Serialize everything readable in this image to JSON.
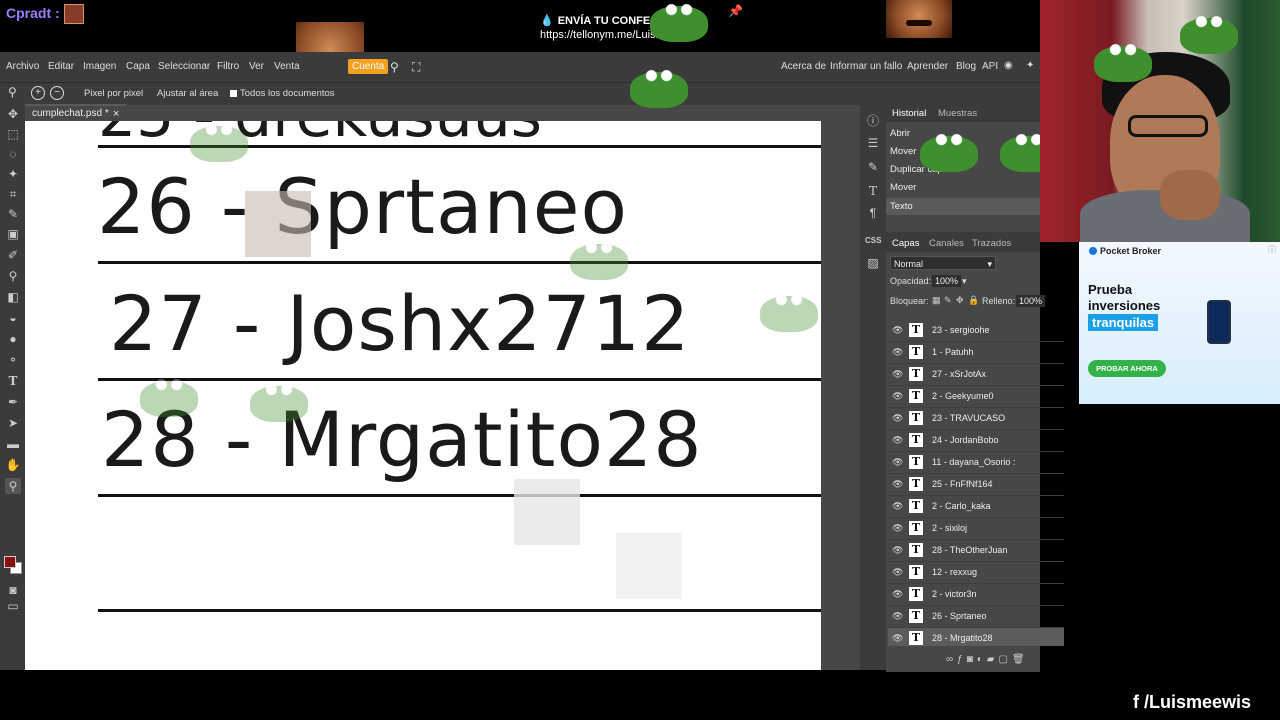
{
  "stream": {
    "chat_user": "Cpradt :",
    "alert_line1": "ENVÍA TU CONFESI",
    "alert_line2": "https://tellonym.me/Luismeewis",
    "social_handle": "/Luismeewis"
  },
  "menu": {
    "items": [
      "Archivo",
      "Editar",
      "Imagen",
      "Capa",
      "Seleccionar",
      "Filtro",
      "Ver",
      "Venta",
      "Cuenta"
    ],
    "right_items": [
      "Acerca de",
      "Informar un fallo",
      "Aprender",
      "Blog",
      "API"
    ]
  },
  "options": {
    "pixel": "Pixel por pixel",
    "fit": "Ajustar al área",
    "all_docs": "Todos los documentos"
  },
  "document": {
    "tab_name": "cumplechat.psd *",
    "entries": [
      "26 - Sprtaneo",
      "27 - Joshx2712",
      "28 - Mrgatito28"
    ]
  },
  "history_panel": {
    "tabs": [
      "Historial",
      "Muestras"
    ],
    "items": [
      "Abrir",
      "Mover",
      "Duplicar capa",
      "Mover",
      "Texto"
    ],
    "selected_index": 4
  },
  "layers_panel": {
    "tabs": [
      "Capas",
      "Canales",
      "Trazados"
    ],
    "blend_mode": "Normal",
    "opacity_label": "Opacidad:",
    "opacity_value": "100%",
    "lock_label": "Bloquear:",
    "fill_label": "Relleno:",
    "fill_value": "100%",
    "layers": [
      "23 - sergioohe",
      "1 - Patuhh",
      "27 - xSrJotAx",
      "2 - Geekyume0",
      "23 - TRAVUCASO",
      "24 - JordanBobo",
      "11 - dayana_Osorio :",
      "25 - FnFfNf164",
      "2 - Carlo_kaka",
      "2 - sixiloj",
      "28 - TheOtherJuan",
      "12 - rexxug",
      "2 - victor3n",
      "26 - Sprtaneo",
      "28 - Mrgatito28"
    ],
    "selected_layer": "28 - Mrgatito28"
  },
  "ad": {
    "brand": "Pocket Broker",
    "headline1": "Prueba",
    "headline2": "inversiones",
    "highlight": "tranquilas",
    "cta": "PROBAR AHORA"
  },
  "colors": {
    "foreground": "#8b0e0e",
    "background": "#ffffff",
    "account_button": "#f4a020",
    "chat_user": "#9b7cff"
  }
}
